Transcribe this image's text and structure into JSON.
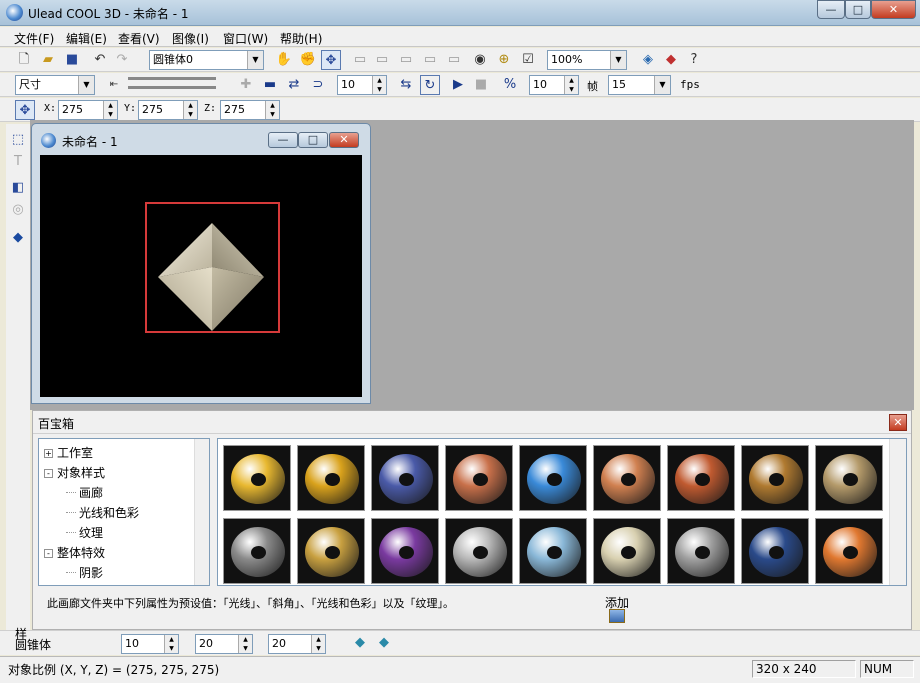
{
  "window": {
    "title": "Ulead COOL 3D - 未命名 - 1",
    "minimize": "—",
    "maximize": "□",
    "close": "✕"
  },
  "menu": [
    "文件(F)",
    "编辑(E)",
    "查看(V)",
    "图像(I)",
    "窗口(W)",
    "帮助(H)"
  ],
  "toolbar1": {
    "object_select": "圆锥体0",
    "zoom": "100%"
  },
  "toolbar2": {
    "mode": "尺寸",
    "frame_value": "10",
    "speed_value": "10",
    "frame_label": "帧",
    "fps_value": "15",
    "fps_label": "fps"
  },
  "toolbar3": {
    "x_label": "X:",
    "x_value": "275",
    "y_label": "Y:",
    "y_value": "275",
    "z_label": "Z:",
    "z_value": "275"
  },
  "document": {
    "title": "未命名 - 1"
  },
  "gallery": {
    "title": "百宝箱",
    "tree": [
      {
        "label": "工作室",
        "expander": "+",
        "indent": 0
      },
      {
        "label": "对象样式",
        "expander": "-",
        "indent": 0
      },
      {
        "label": "画廊",
        "expander": "",
        "indent": 1
      },
      {
        "label": "光线和色彩",
        "expander": "",
        "indent": 1
      },
      {
        "label": "纹理",
        "expander": "",
        "indent": 1
      },
      {
        "label": "整体特效",
        "expander": "-",
        "indent": 0
      },
      {
        "label": "阴影",
        "expander": "",
        "indent": 1
      }
    ],
    "thumb_colors": [
      [
        "#e8b830",
        "#d9a21c",
        "#4a5aa8",
        "#c8704a",
        "#3a8ad8",
        "#d08050",
        "#c05a30",
        "#b07a30",
        "#b49a6a"
      ],
      [
        "#8a8a8a",
        "#c8a040",
        "#7a3aa0",
        "#b8b8b8",
        "#8ab8d8",
        "#d8d0b0",
        "#a0a0a0",
        "#2a4a8a",
        "#e07830"
      ]
    ],
    "description": "此画廊文件夹中下列属性为预设值：「光线」、「斜角」、「光线和色彩」以及「纹理」。",
    "add_label": "添加"
  },
  "propbar": {
    "side_tab": "样",
    "object_name": "圆锥体",
    "value1": "10",
    "value2": "20",
    "value3": "20"
  },
  "status": {
    "ratio_text": "对象比例 (X, Y, Z) = (275, 275, 275)",
    "size_text": "320 x 240",
    "num_text": "NUM"
  }
}
